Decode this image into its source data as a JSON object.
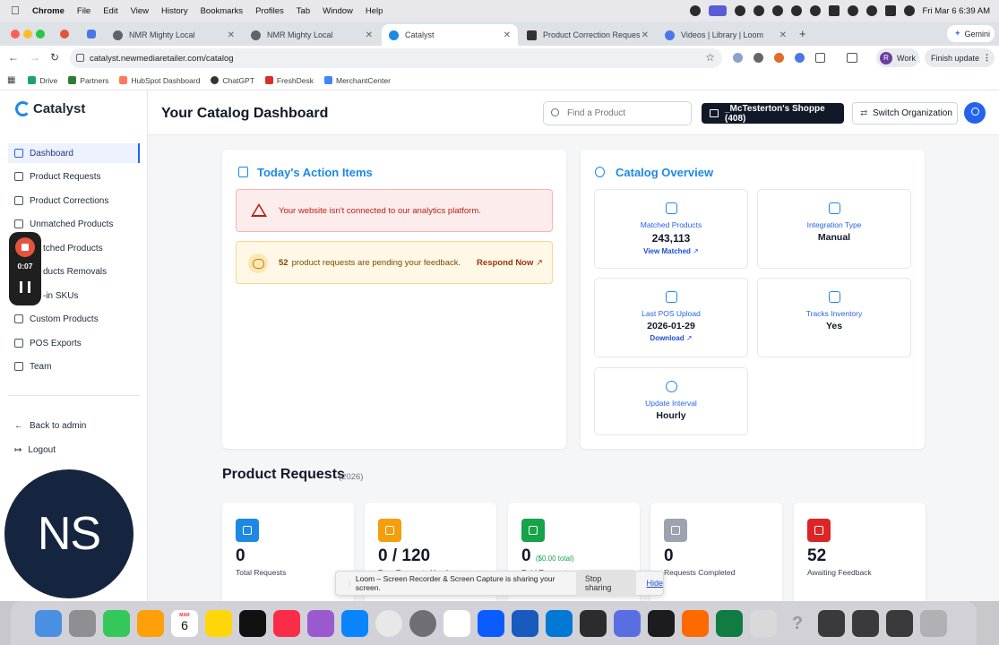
{
  "macos": {
    "app_name": "Chrome",
    "menus": [
      "File",
      "Edit",
      "View",
      "History",
      "Bookmarks",
      "Profiles",
      "Tab",
      "Window",
      "Help"
    ],
    "clock": "Fri Mar 6  6:39 AM"
  },
  "browser": {
    "tabs": [
      {
        "title": "NMR Mighty Local",
        "active": false
      },
      {
        "title": "NMR Mighty Local",
        "active": false
      },
      {
        "title": "Catalyst",
        "active": true
      },
      {
        "title": "Product Correction Requests",
        "active": false
      },
      {
        "title": "Videos | Library | Loom",
        "active": false
      }
    ],
    "gemini_label": "Gemini",
    "url": "catalyst.newmediaretailer.com/catalog",
    "profile_label": "Work",
    "profile_initial": "R",
    "update_label": "Finish update",
    "bookmarks": [
      "Drive",
      "Partners",
      "HubSpot Dashboard",
      "ChatGPT",
      "FreshDesk",
      "MerchantCenter"
    ]
  },
  "sidebar": {
    "brand": "Catalyst",
    "items": [
      {
        "label": "Dashboard",
        "active": true
      },
      {
        "label": "Product Requests"
      },
      {
        "label": "Product Corrections"
      },
      {
        "label": "Unmatched Products"
      },
      {
        "label": "tched Products"
      },
      {
        "label": "ducts Removals"
      },
      {
        "label": "-in SKUs"
      },
      {
        "label": "Custom Products"
      },
      {
        "label": "POS Exports"
      },
      {
        "label": "Team"
      }
    ],
    "back_label": "Back to admin",
    "logout_label": "Logout"
  },
  "header": {
    "title": "Your Catalog Dashboard",
    "search_placeholder": "Find a Product",
    "org_label": "_McTesterton's Shoppe (408)",
    "switch_label": "Switch Organization"
  },
  "action_items": {
    "title": "Today's Action Items",
    "alert_text": "Your website isn't connected to our analytics platform.",
    "pending_count": "52",
    "pending_text": "product requests are pending your feedback.",
    "respond_label": "Respond Now"
  },
  "overview": {
    "title": "Catalog Overview",
    "tiles": [
      {
        "label": "Matched Products",
        "value": "243,113",
        "link": "View Matched"
      },
      {
        "label": "Integration Type",
        "value": "Manual"
      },
      {
        "label": "Last POS Upload",
        "value": "2026-01-29",
        "link": "Download"
      },
      {
        "label": "Tracks Inventory",
        "value": "Yes"
      },
      {
        "label": "Update Interval",
        "value": "Hourly"
      }
    ]
  },
  "product_requests": {
    "heading": "Product Requests",
    "year": "(2026)",
    "stats": [
      {
        "value": "0",
        "label": "Total Requests",
        "color": "#1e88e5"
      },
      {
        "value": "0 / 120",
        "label": "Free Requests Used",
        "color": "#f59e0b"
      },
      {
        "value": "0",
        "extra": "($0.00 total)",
        "label": "Paid Requests",
        "color": "#16a34a"
      },
      {
        "value": "0",
        "label": "Requests Completed",
        "color": "#9ca3af"
      },
      {
        "value": "52",
        "label": "Awaiting Feedback",
        "color": "#dc2626"
      }
    ]
  },
  "loom": {
    "timer": "0:07",
    "webcam_initials": "NS",
    "share_text": "Loom – Screen Recorder & Screen Capture is sharing your screen.",
    "stop_label": "Stop sharing",
    "hide_label": "Hide"
  },
  "dock": {
    "calendar_month": "MAR",
    "calendar_day": "6"
  }
}
